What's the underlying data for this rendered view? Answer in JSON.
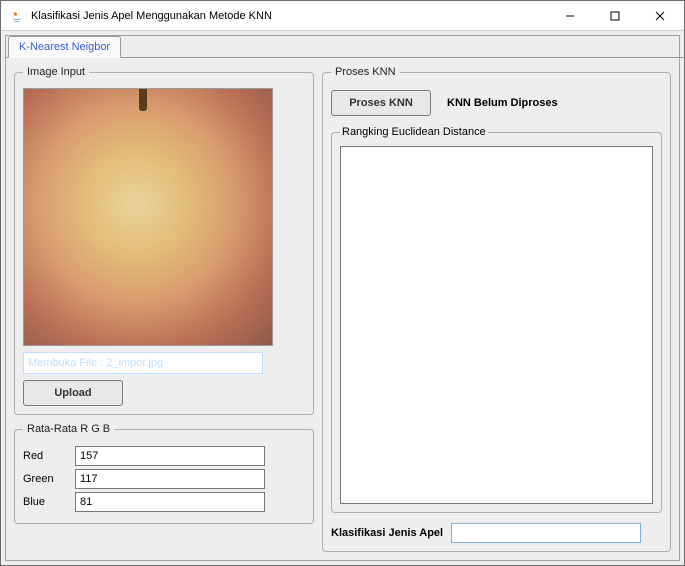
{
  "window": {
    "title": "Klasifikasi Jenis Apel Menggunakan Metode KNN"
  },
  "tab": {
    "label": "K-Nearest Neigbor"
  },
  "imageInput": {
    "legend": "Image Input",
    "filePath": "Membuka File : 2_impor.jpg",
    "uploadLabel": "Upload"
  },
  "rgb": {
    "legend": "Rata-Rata R G B",
    "redLabel": "Red",
    "red": "157",
    "greenLabel": "Green",
    "green": "117",
    "blueLabel": "Blue",
    "blue": "81"
  },
  "proses": {
    "legend": "Proses KNN",
    "buttonLabel": "Proses KNN",
    "statusLabel": "KNN Belum Diproses",
    "rankingLegend": "Rangking Euclidean Distance",
    "classLabel": "Klasifikasi Jenis Apel",
    "classValue": ""
  }
}
